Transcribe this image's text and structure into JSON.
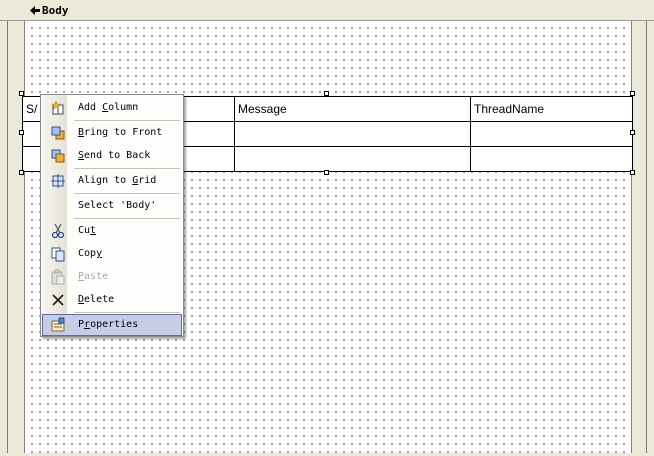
{
  "band": {
    "label": "Body"
  },
  "table": {
    "header": [
      "S/",
      "",
      "Message",
      "ThreadName"
    ],
    "rows": [
      [
        "",
        "",
        "",
        ""
      ],
      [
        "",
        "",
        "",
        ""
      ]
    ]
  },
  "context_menu": {
    "items": [
      {
        "label": "Add Column",
        "icon": "add-column-icon",
        "accel": "C",
        "disabled": false
      },
      {
        "label": "Bring to Front",
        "icon": "bring-to-front-icon",
        "accel": "B",
        "disabled": false
      },
      {
        "label": "Send to Back",
        "icon": "send-to-back-icon",
        "accel": "S",
        "disabled": false
      },
      {
        "label": "Align to Grid",
        "icon": "align-to-grid-icon",
        "accel": "G",
        "disabled": false
      },
      {
        "label": "Select 'Body'",
        "icon": "",
        "accel": "",
        "disabled": false
      },
      {
        "label": "Cut",
        "icon": "cut-icon",
        "accel": "t",
        "disabled": false
      },
      {
        "label": "Copy",
        "icon": "copy-icon",
        "accel": "y",
        "disabled": false
      },
      {
        "label": "Paste",
        "icon": "paste-icon",
        "accel": "P",
        "disabled": true
      },
      {
        "label": "Delete",
        "icon": "delete-icon",
        "accel": "D",
        "disabled": false
      },
      {
        "label": "Properties",
        "icon": "properties-icon",
        "accel": "r",
        "disabled": false,
        "highlighted": true
      }
    ]
  },
  "colors": {
    "menu_highlight": "#c6cde6",
    "menu_highlight_border": "#5d6d9f",
    "surface": "#ffffff",
    "chrome": "#ece9d8"
  }
}
